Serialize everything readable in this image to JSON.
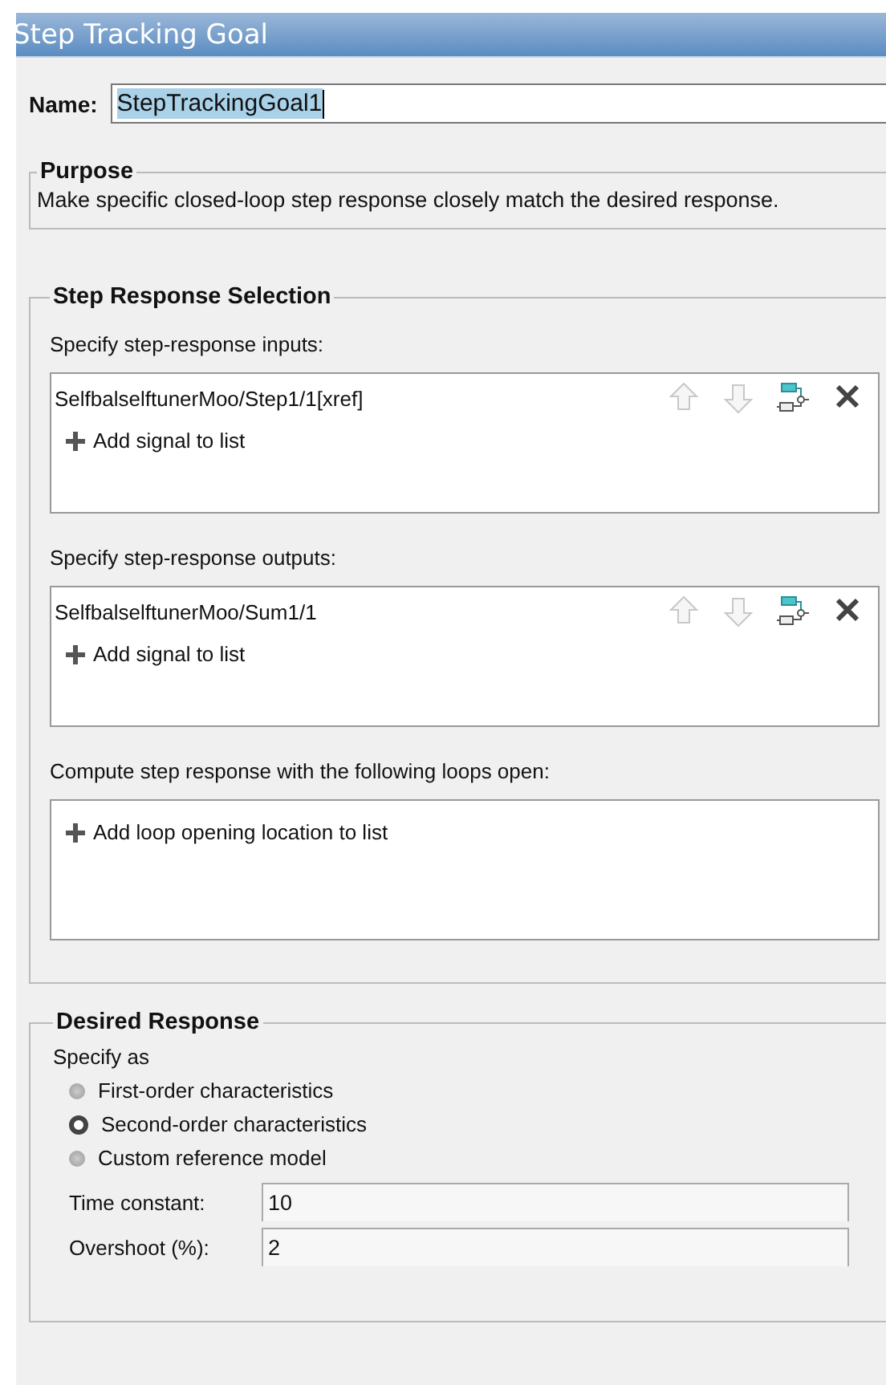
{
  "window": {
    "title": "Step Tracking Goal"
  },
  "name": {
    "label": "Name:",
    "value": "StepTrackingGoal1"
  },
  "purpose": {
    "title": "Purpose",
    "text": "Make specific closed-loop step response closely match the desired response."
  },
  "step_response_selection": {
    "title": "Step Response Selection",
    "lists": [
      {
        "label": "Specify step-response inputs:",
        "signals": [
          "SelfbalselftunerMoo/Step1/1[xref]"
        ],
        "add": "Add signal to list"
      },
      {
        "label": "Specify step-response outputs:",
        "signals": [
          "SelfbalselftunerMoo/Sum1/1"
        ],
        "add": "Add signal to list"
      },
      {
        "label": "Compute step response with the following loops open:",
        "add": "Add loop opening location to list"
      }
    ]
  },
  "desired_response": {
    "title": "Desired Response",
    "specify_label": "Specify as",
    "options": [
      {
        "label": "First-order characteristics",
        "selected": false
      },
      {
        "label": "Second-order characteristics",
        "selected": true
      },
      {
        "label": "Custom reference model",
        "selected": false
      }
    ],
    "fields": [
      {
        "label": "Time constant:",
        "value": "10"
      },
      {
        "label": "Overshoot (%):",
        "value": "2"
      }
    ]
  }
}
